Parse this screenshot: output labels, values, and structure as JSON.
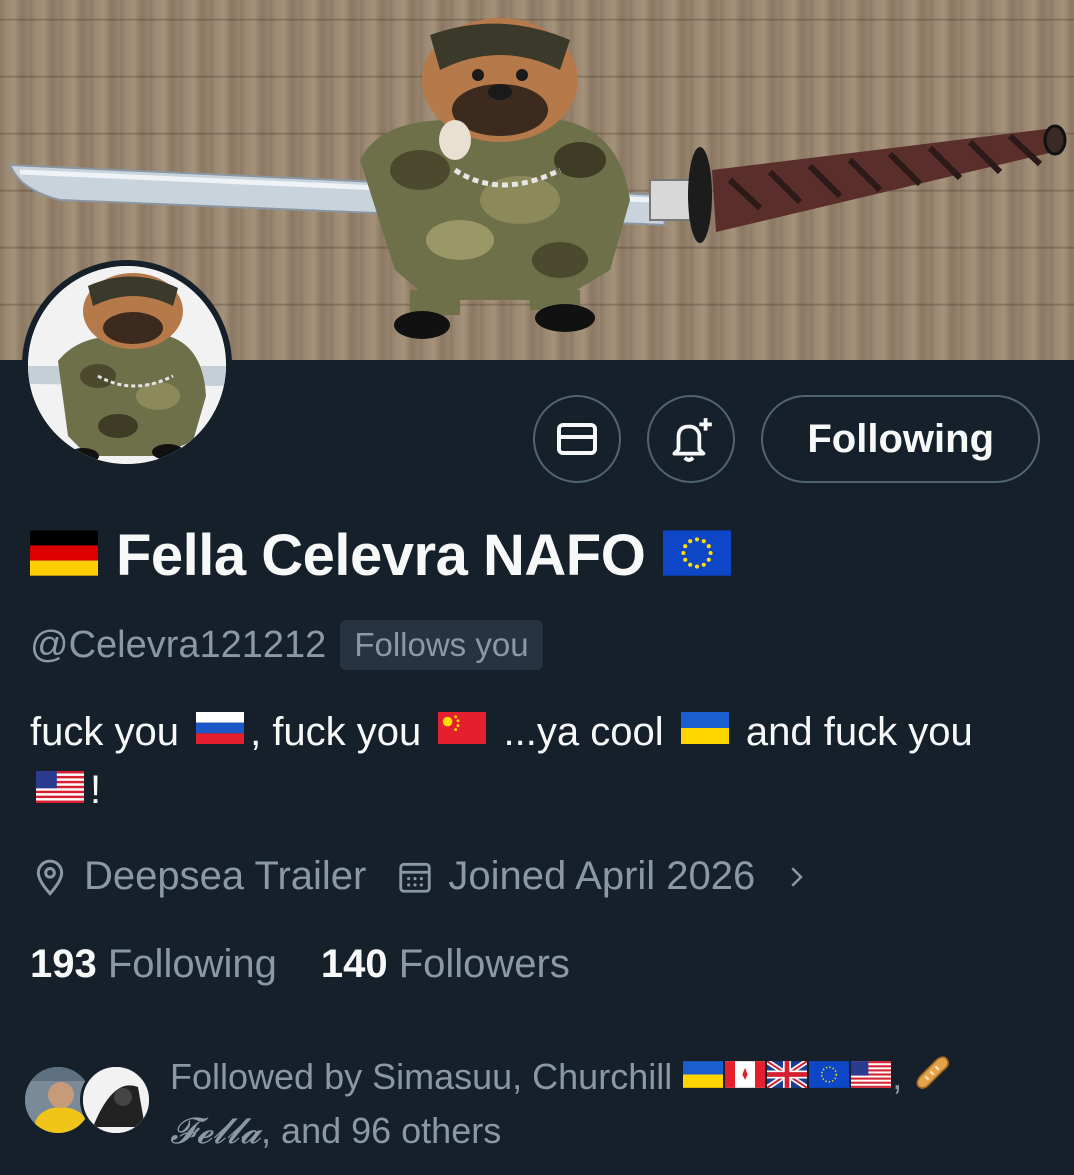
{
  "profile": {
    "display_name": "Fella Celevra NAFO",
    "handle": "@Celevra121212",
    "follows_you_badge": "Follows you",
    "bio": {
      "part1": "fuck you",
      "part2": ", fuck you",
      "part3": "...ya cool",
      "part4": "and fuck you",
      "part5": "!"
    },
    "location": "Deepsea Trailer",
    "joined": "Joined April 2026"
  },
  "actions": {
    "follow_label": "Following"
  },
  "stats": {
    "following_count": "193",
    "following_label": "Following",
    "followers_count": "140",
    "followers_label": "Followers"
  },
  "followed_by": {
    "prefix": "Followed by Simasuu, Churchill",
    "fella_name": "𝓕𝓮𝓵𝓵𝓪",
    "suffix": ", and 96 others"
  },
  "icons": {
    "message": "envelope-icon",
    "notify": "bell-plus-icon",
    "location": "location-pin-icon",
    "calendar": "calendar-icon",
    "chevron": "chevron-right-icon",
    "baguette": "baguette-emoji"
  },
  "colors": {
    "background": "#15202b",
    "text_primary": "#f7f9f9",
    "text_secondary": "#8b98a5",
    "border": "#536471",
    "badge_bg": "#273340"
  }
}
